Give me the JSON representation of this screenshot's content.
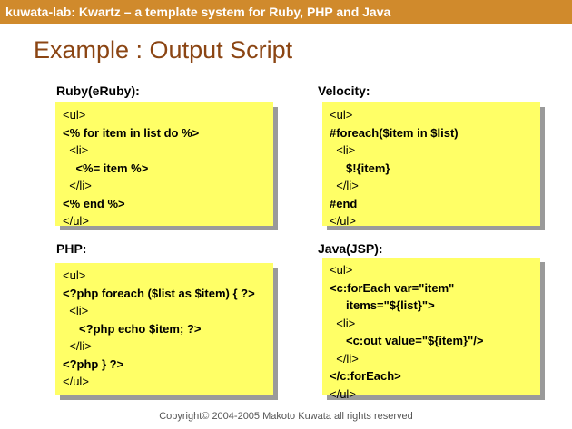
{
  "banner": {
    "text": "kuwata-lab:  Kwartz – a template system for Ruby, PHP and Java"
  },
  "slide": {
    "title": "Example : Output Script"
  },
  "panels": [
    {
      "label": "Ruby(eRuby):",
      "lines": [
        {
          "text": "<ul>",
          "bold": false
        },
        {
          "text": "<% for item in list do %>",
          "bold": true
        },
        {
          "text": "  <li>",
          "bold": false
        },
        {
          "text": "    <%= item %>",
          "bold": true
        },
        {
          "text": "  </li>",
          "bold": false
        },
        {
          "text": "<% end %>",
          "bold": true
        },
        {
          "text": "</ul>",
          "bold": false
        }
      ]
    },
    {
      "label": "Velocity:",
      "lines": [
        {
          "text": "<ul>",
          "bold": false
        },
        {
          "text": "#foreach($item in $list)",
          "bold": true
        },
        {
          "text": "  <li>",
          "bold": false
        },
        {
          "text": "     $!{item}",
          "bold": true
        },
        {
          "text": "  </li>",
          "bold": false
        },
        {
          "text": "#end",
          "bold": true
        },
        {
          "text": "</ul>",
          "bold": false
        }
      ]
    },
    {
      "label": "PHP:",
      "lines": [
        {
          "text": "<ul>",
          "bold": false
        },
        {
          "text": "<?php foreach ($list as $item) { ?>",
          "bold": true
        },
        {
          "text": "  <li>",
          "bold": false
        },
        {
          "text": "     <?php echo $item; ?>",
          "bold": true
        },
        {
          "text": "  </li>",
          "bold": false
        },
        {
          "text": "<?php } ?>",
          "bold": true
        },
        {
          "text": "</ul>",
          "bold": false
        }
      ]
    },
    {
      "label": "Java(JSP):",
      "lines": [
        {
          "text": "<ul>",
          "bold": false
        },
        {
          "text": "<c:forEach var=\"item\"",
          "bold": true
        },
        {
          "text": "     items=\"${list}\">",
          "bold": true
        },
        {
          "text": "  <li>",
          "bold": false
        },
        {
          "text": "     <c:out value=\"${item}\"/>",
          "bold": true
        },
        {
          "text": "  </li>",
          "bold": false
        },
        {
          "text": "</c:forEach>",
          "bold": true
        },
        {
          "text": "</ul>",
          "bold": false
        }
      ]
    }
  ],
  "footer": {
    "text": "Copyright© 2004-2005 Makoto Kuwata all rights reserved"
  }
}
